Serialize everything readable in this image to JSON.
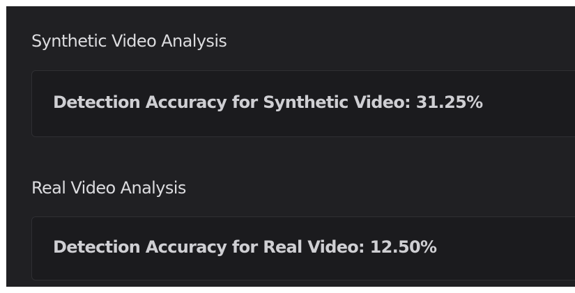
{
  "synthetic": {
    "title": "Synthetic Video Analysis",
    "result_text": "Detection Accuracy for Synthetic Video: 31.25%"
  },
  "real": {
    "title": "Real Video Analysis",
    "result_text": "Detection Accuracy for Real Video: 12.50%"
  },
  "colors": {
    "background": "#202023",
    "card_background": "#1b1b1e",
    "text": "#dcdcdf"
  }
}
